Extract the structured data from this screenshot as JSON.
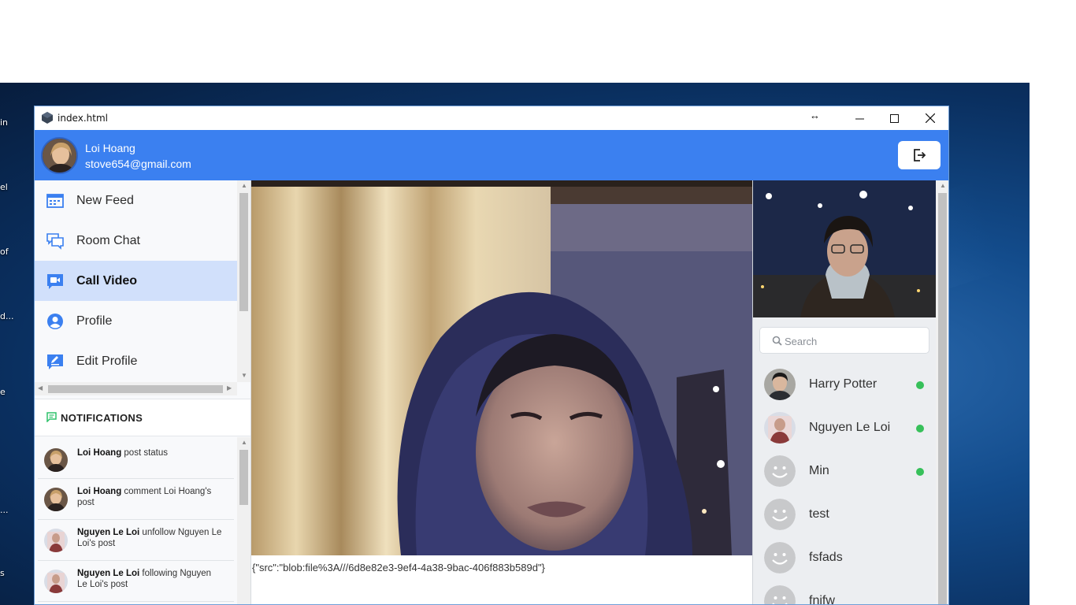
{
  "window": {
    "title": "index.html",
    "resize_glyph": "↔",
    "minimize_glyph": "─",
    "maximize_glyph": "☐",
    "close_glyph": "✕"
  },
  "desktop": {
    "labels": [
      "in",
      "el",
      "of",
      "d...",
      "e",
      "...",
      "s"
    ]
  },
  "user": {
    "name": "Loi Hoang",
    "email": "stove654@gmail.com"
  },
  "nav": {
    "items": [
      {
        "label": "New Feed",
        "icon": "newsfeed-icon",
        "active": false
      },
      {
        "label": "Room Chat",
        "icon": "chat-icon",
        "active": false
      },
      {
        "label": "Call Video",
        "icon": "video-call-icon",
        "active": true
      },
      {
        "label": "Profile",
        "icon": "profile-icon",
        "active": false
      },
      {
        "label": "Edit Profile",
        "icon": "edit-profile-icon",
        "active": false
      }
    ]
  },
  "notifications": {
    "title": "NOTIFICATIONS",
    "items": [
      {
        "actor": "Loi Hoang",
        "text": " post status"
      },
      {
        "actor": "Loi Hoang",
        "text": " comment Loi Hoang's post"
      },
      {
        "actor": "Nguyen Le Loi",
        "text": " unfollow Nguyen Le Loi's post"
      },
      {
        "actor": "Nguyen Le Loi",
        "text": " following Nguyen Le Loi's post"
      }
    ]
  },
  "video": {
    "info": "{\"src\":\"blob:file%3A///6d8e82e3-9ef4-4a38-9bac-406f883b589d\"}"
  },
  "search": {
    "placeholder": "Search"
  },
  "contacts": [
    {
      "name": "Harry Potter",
      "online": true,
      "avatar": "photo"
    },
    {
      "name": "Nguyen Le Loi",
      "online": true,
      "avatar": "photo"
    },
    {
      "name": "Min",
      "online": true,
      "avatar": "default"
    },
    {
      "name": "test",
      "online": false,
      "avatar": "default"
    },
    {
      "name": "fsfads",
      "online": false,
      "avatar": "default"
    },
    {
      "name": "fnjfw",
      "online": false,
      "avatar": "default"
    }
  ],
  "colors": {
    "accent": "#3b80f0",
    "active_nav": "#d1e0fb",
    "online": "#37c05a",
    "notification_icon": "#2ec26b"
  }
}
